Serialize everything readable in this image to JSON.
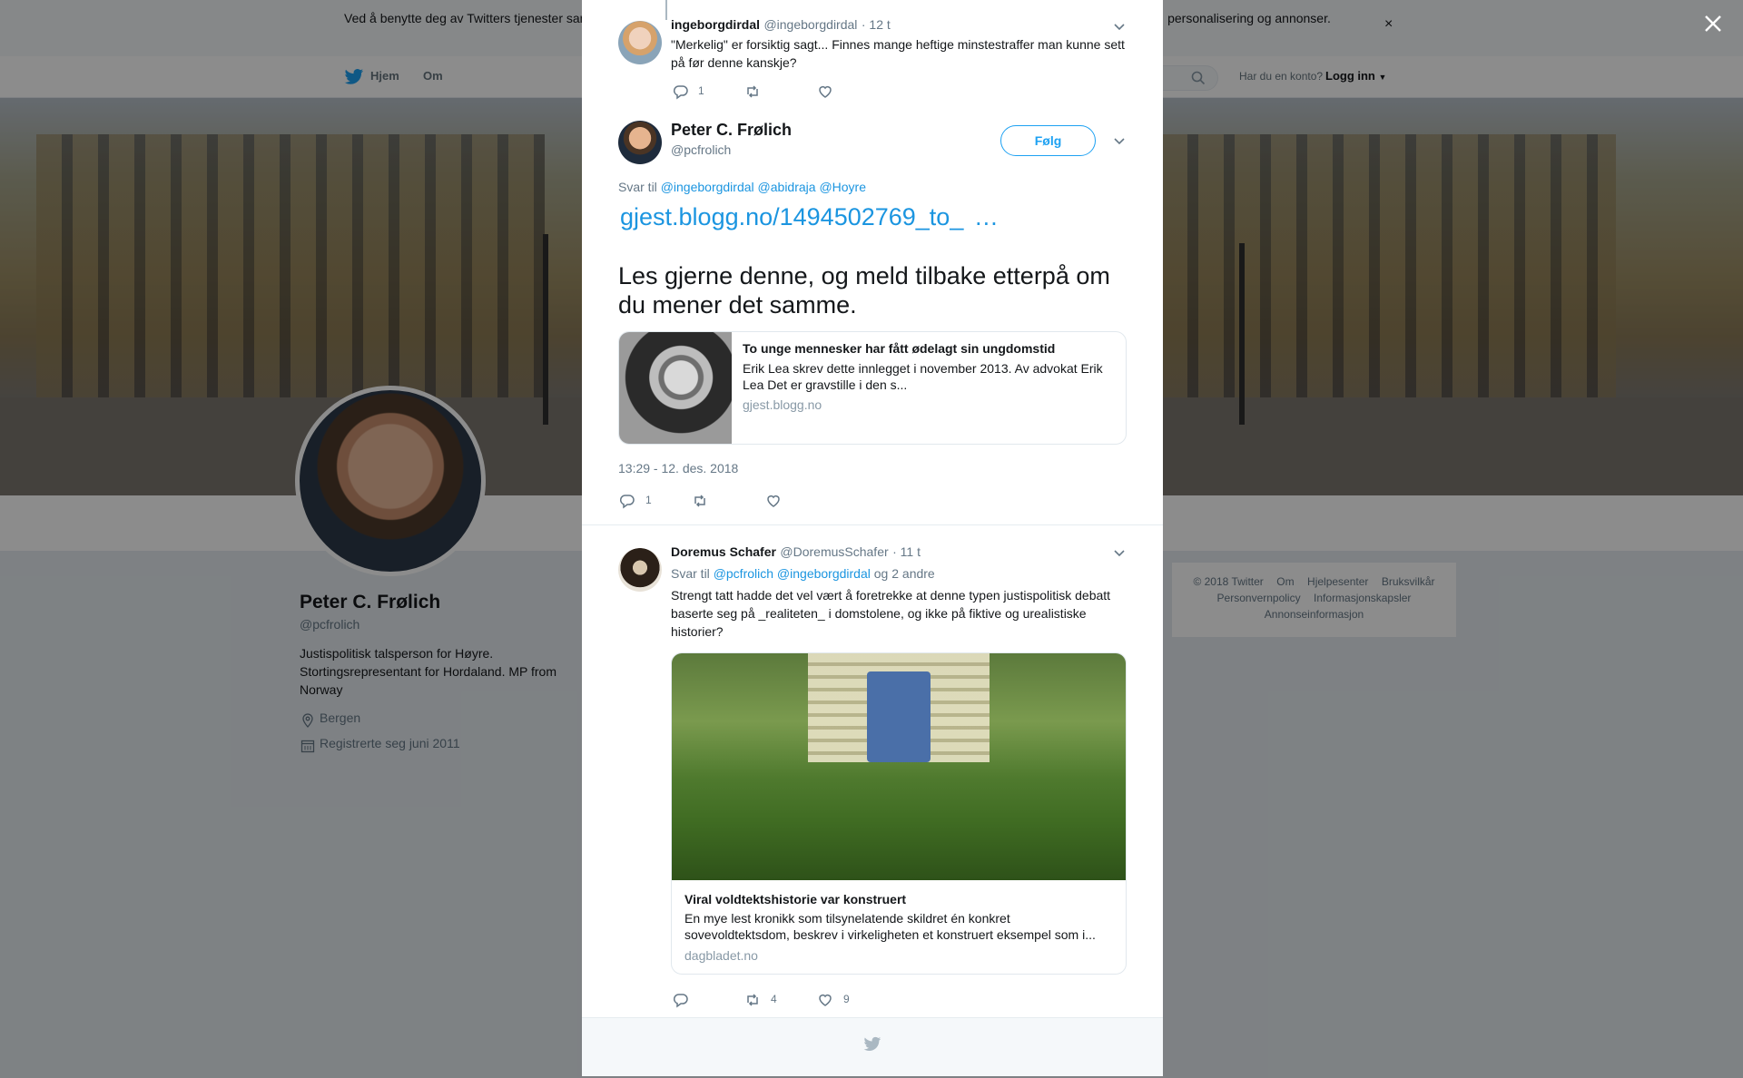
{
  "cookie_banner": {
    "text": "Ved å benytte deg av Twitters tjenester samtykker du i vår bruk av informasjonskapsler og deling av data om informasjonskapsler til bl.a. analyser, personalisering og annonser.",
    "close": "×"
  },
  "nav": {
    "home": "Hjem",
    "about": "Om",
    "account_question": "Har du en konto?",
    "login": "Logg inn"
  },
  "profile": {
    "name": "Peter C. Frølich",
    "handle": "@pcfrolich",
    "bio": "Justispolitisk talsperson for Høyre. Stortingsrepresentant for Hordaland. MP from Norway",
    "location": "Bergen",
    "joined": "Registrerte seg juni 2011"
  },
  "footer_links": [
    "© 2018 Twitter",
    "Om",
    "Hjelpesenter",
    "Bruksvilkår",
    "Personvernpolicy",
    "Informasjonskapsler",
    "Annonseinformasjon"
  ],
  "thread": {
    "parent": {
      "name": "ingeborgdirdal",
      "handle": "@ingeborgdirdal",
      "time": "· 12 t",
      "text": "\"Merkelig\" er forsiktig sagt... Finnes mange heftige minstestraffer man kunne sett på før denne kanskje?",
      "reply_count": "1",
      "retweet_count": "",
      "like_count": ""
    },
    "main": {
      "name": "Peter C. Frølich",
      "handle": "@pcfrolich",
      "follow_label": "Følg",
      "reply_prefix": "Svar til",
      "reply_to": [
        "@ingeborgdirdal",
        "@abidraja",
        "@Hoyre"
      ],
      "link": "gjest.blogg.no/1494502769_to_",
      "link_ellipsis": "…",
      "text": "Les gjerne denne, og meld tilbake etterpå om du mener det samme.",
      "card": {
        "title": "To unge mennesker har fått ødelagt sin ungdomstid",
        "description": "Erik Lea skrev dette innlegget i november 2013. Av advokat Erik Lea Det er gravstille i den s...",
        "domain": "gjest.blogg.no"
      },
      "timestamp": "13:29 - 12. des. 2018",
      "reply_count": "1",
      "retweet_count": "",
      "like_count": ""
    },
    "reply": {
      "name": "Doremus Schafer",
      "handle": "@DoremusSchafer",
      "time": "· 11 t",
      "reply_prefix": "Svar til",
      "reply_to": [
        "@pcfrolich",
        "@ingeborgdirdal"
      ],
      "reply_suffix": "og 2 andre",
      "text": "Strengt tatt hadde det vel vært å foretrekke  at denne typen justispolitisk debatt baserte seg på _realiteten_ i domstolene, og ikke på fiktive og urealistiske historier?",
      "card": {
        "title": "Viral voldtektshistorie var konstruert",
        "description": "En mye lest kronikk som tilsynelatende skildret én konkret sovevoldtektsdom, beskrev i virkeligheten et konstruert eksempel som i...",
        "domain": "dagbladet.no"
      },
      "reply_count": "",
      "retweet_count": "4",
      "like_count": "9"
    }
  },
  "colors": {
    "link": "#1b95e0",
    "twitter_blue": "#1da1f2",
    "muted": "#657786",
    "text": "#14171a"
  }
}
